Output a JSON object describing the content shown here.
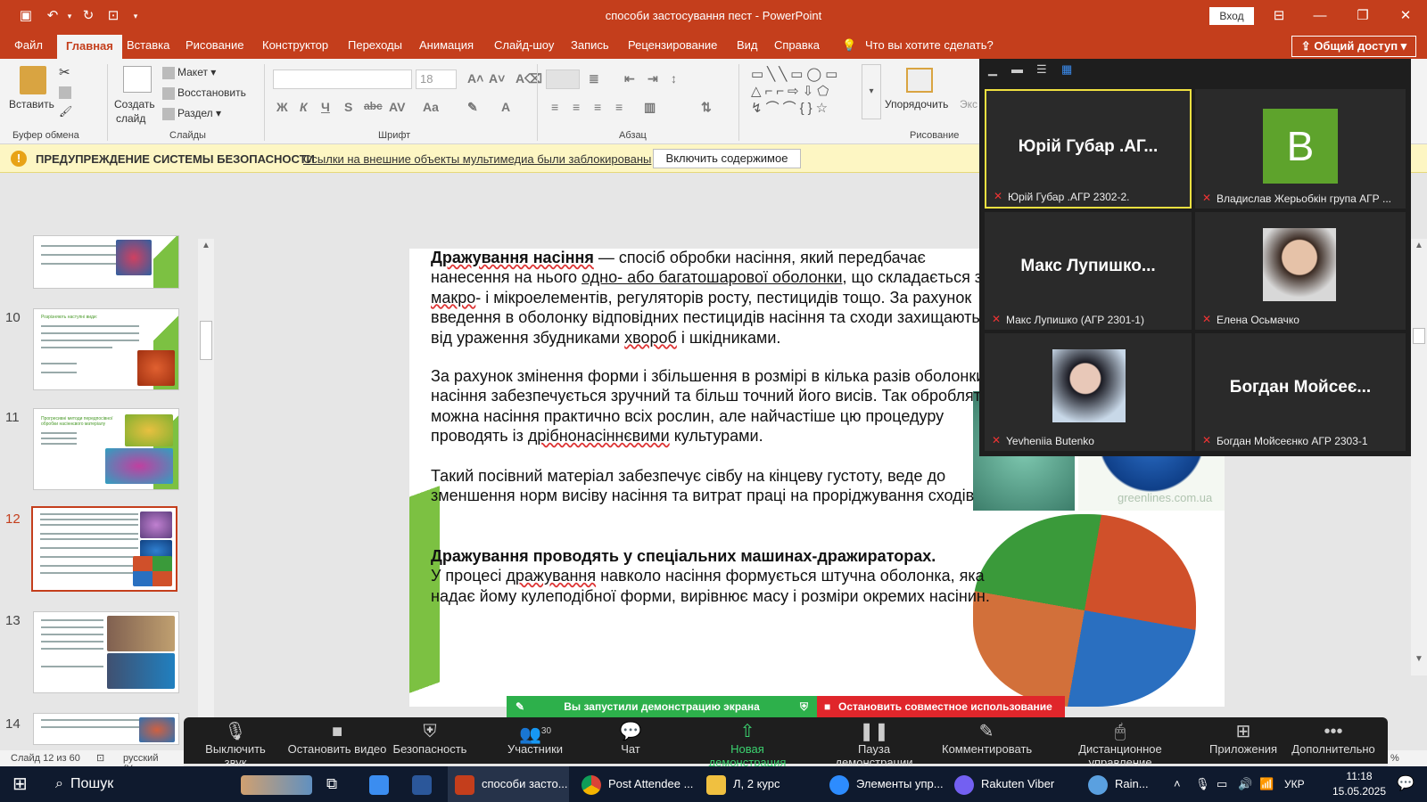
{
  "app": {
    "title": "способи застосування пест  -  PowerPoint",
    "signin": "Вход",
    "share": "Общий доступ",
    "tell_me": "Что вы хотите сделать?",
    "tabs": [
      "Файл",
      "Главная",
      "Вставка",
      "Рисование",
      "Конструктор",
      "Переходы",
      "Анимация",
      "Слайд-шоу",
      "Запись",
      "Рецензирование",
      "Вид",
      "Справка"
    ]
  },
  "ribbon": {
    "paste": "Вставить",
    "clipboard": "Буфер обмена",
    "new_slide": "Создать",
    "new_slide2": "слайд",
    "layout": "Макет",
    "reset": "Восстановить",
    "section": "Раздел",
    "slides": "Слайды",
    "font_size": "18",
    "font": "Шрифт",
    "paragraph": "Абзац",
    "arrange": "Упорядочить",
    "drawing": "Рисование",
    "express": "Экс",
    "bold": "Ж",
    "italic": "К",
    "underline": "Ч",
    "strike": "S"
  },
  "security": {
    "title": "ПРЕДУПРЕЖДЕНИЕ СИСТЕМЫ БЕЗОПАСНОСТИ",
    "message": "Ссылки на внешние объекты мультимедиа были заблокированы",
    "button": "Включить содержимое"
  },
  "thumbnails": {
    "numbers": [
      "10",
      "11",
      "12",
      "13",
      "14"
    ],
    "t10_title": "Розрізняють наступні види:",
    "t11_title": "Прогресивні методи передпосівної обробки насіннєвого матеріалу"
  },
  "slide": {
    "p1_b": "Дражування насіння",
    "p1_a": " — спосіб обробки насіння, який передбачає нанесення на нього ",
    "p1_u": "одно- або багатошарової оболонки",
    "p1_c": ", що складається з ",
    "p1_w1": "макро",
    "p1_d": "- і мікроелементів, регуляторів росту, пестицидів тощо. За рахунок введення  в оболонку відповідних пестицидів насіння та сходи захищаються від ураження збудниками ",
    "p1_w2": "хвороб",
    "p1_e": " і шкідниками.",
    "p2_a": "За рахунок змінення форми і збільшення в розмірі в кілька разів оболонки насіння забезпечується зручний та  більш точний його висів. Так обробляти можна насіння практично всіх рослин, але найчастіше цю процедуру проводять із ",
    "p2_w": "дрібнонасіннєвими",
    "p2_b": " культурами.",
    "p3": "Такий посівний матеріал забезпечує сівбу на кінцеву густоту, веде до зменшення норм висіву насіння та витрат праці на проріджування сходів",
    "p4_b": "Дражування проводять у спеціальних машинах-дражираторах.",
    "p4_a": "У процесі ",
    "p4_w": "дражування",
    "p4_c": " навколо насіння формується штучна оболонка, яка надає йому кулеподібної форми, вирівнює масу і розміри окремих насінин.",
    "watermark": "greenlines.com.ua"
  },
  "zoom": {
    "tiles": [
      {
        "big": "Юрій Губар .АГ...",
        "label": "Юрій Губар .АГР 2302-2."
      },
      {
        "big": "B",
        "label": "Владислав Жерьобкін група АГР ..."
      },
      {
        "big": "Макс  Лупишко...",
        "label": "Макс Лупишко (АГР 2301-1)"
      },
      {
        "big": "",
        "label": "Елена Осьмачко"
      },
      {
        "big": "",
        "label": "Yevheniia Butenko"
      },
      {
        "big": "Богдан  Мойсеє...",
        "label": "Богдан Мойсеєнко АГР 2303-1"
      }
    ],
    "banner_started": "Вы запустили демонстрацию экрана",
    "banner_stop": "Остановить совместное использование",
    "toolbar": [
      "Выключить звук",
      "Остановить видео",
      "Безопасность",
      "Участники",
      "Чат",
      "Новая демонстрация",
      "Пауза демонстрации",
      "Комментировать",
      "Дистанционное управление",
      "Приложения",
      "Дополнительно"
    ],
    "participants_count": "30"
  },
  "status": {
    "slide": "Слайд 12 из 60",
    "lang": "русский (Укра",
    "zoom_pct": "%"
  },
  "taskbar": {
    "search": "Пошук",
    "apps": [
      "способи засто...",
      "Post Attendee ...",
      "Л, 2 курс",
      "Элементы упр...",
      "Rakuten Viber",
      "Rain..."
    ],
    "lang": "УКР",
    "time": "11:18",
    "date": "15.05.2025"
  },
  "colors": {
    "accent": "#c43e1c",
    "zoom_green": "#2db04b",
    "zoom_red": "#e0262b"
  }
}
